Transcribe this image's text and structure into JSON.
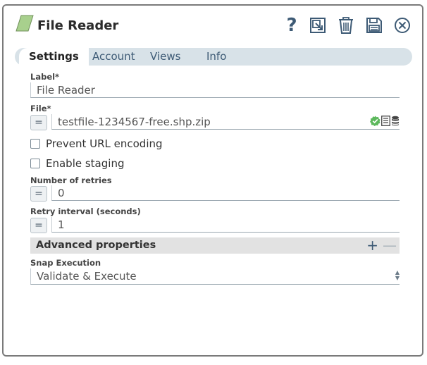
{
  "window": {
    "title": "File Reader"
  },
  "toolbar": {
    "help_glyph": "?",
    "icons": [
      "help-icon",
      "export-icon",
      "trash-icon",
      "save-icon",
      "close-icon"
    ]
  },
  "tabs": [
    {
      "label": "Settings",
      "active": true
    },
    {
      "label": "Account",
      "active": false
    },
    {
      "label": "Views",
      "active": false
    },
    {
      "label": "Info",
      "active": false
    }
  ],
  "form": {
    "label": {
      "label": "Label*",
      "value": "File Reader"
    },
    "file": {
      "label": "File*",
      "value": "testfile-1234567-free.shp.zip",
      "expr": "="
    },
    "prevent_url_encoding": {
      "label": "Prevent URL encoding",
      "checked": false
    },
    "enable_staging": {
      "label": "Enable staging",
      "checked": false
    },
    "retries": {
      "label": "Number of retries",
      "value": "0",
      "expr": "="
    },
    "retry_interval": {
      "label": "Retry interval (seconds)",
      "value": "1",
      "expr": "="
    },
    "advanced": {
      "title": "Advanced properties",
      "add": "+",
      "remove": "—"
    },
    "snap_execution": {
      "label": "Snap Execution",
      "value": "Validate & Execute"
    }
  },
  "colors": {
    "accent": "#3d5a75",
    "tab_bar": "#d8e2e8",
    "logo": "#a8d08d",
    "valid": "#5cb85c"
  }
}
